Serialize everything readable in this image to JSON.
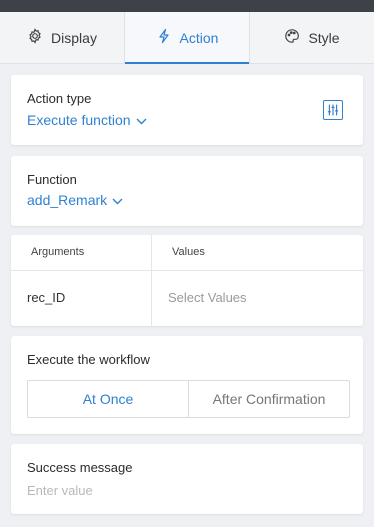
{
  "tabs": [
    {
      "label": "Display",
      "icon": "gear-icon",
      "active": false
    },
    {
      "label": "Action",
      "icon": "lightning-icon",
      "active": true
    },
    {
      "label": "Style",
      "icon": "palette-icon",
      "active": false
    }
  ],
  "action_type": {
    "label": "Action type",
    "value": "Execute function",
    "icon": "filter-settings-icon"
  },
  "function": {
    "label": "Function",
    "value": "add_Remark"
  },
  "arguments": {
    "headers": [
      "Arguments",
      "Values"
    ],
    "rows": [
      {
        "name": "rec_ID",
        "value": "Select Values"
      }
    ]
  },
  "workflow": {
    "label": "Execute the workflow",
    "options": [
      "At Once",
      "After Confirmation"
    ],
    "selected": "At Once"
  },
  "success_message": {
    "label": "Success message",
    "placeholder": "Enter value"
  },
  "colors": {
    "accent": "#2f80d1",
    "background": "#eef0f3",
    "topbar": "#3e4148"
  }
}
